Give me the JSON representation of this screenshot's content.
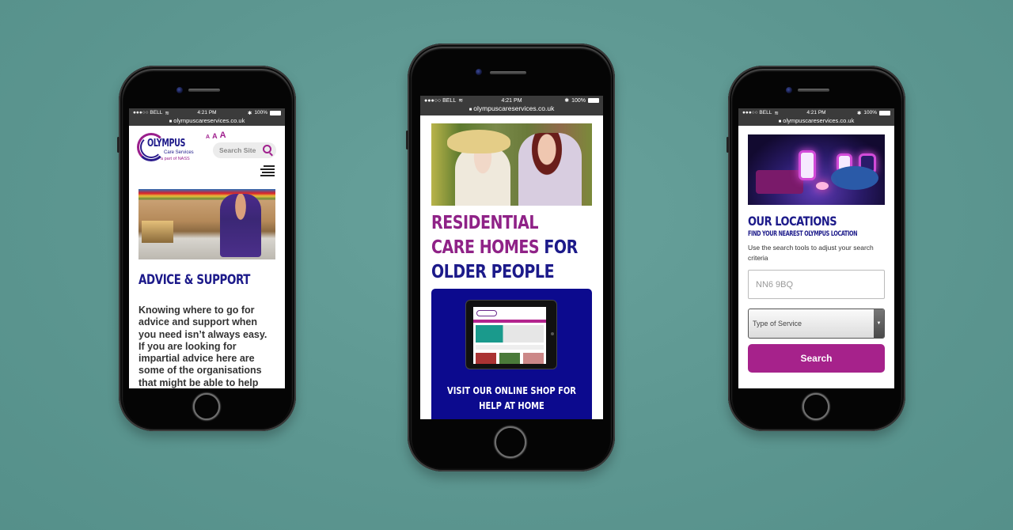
{
  "status_bar": {
    "carrier": "●●●○○ BELL",
    "wifi_icon": "wifi-icon",
    "time": "4:21 PM",
    "bluetooth_icon": "✱",
    "battery": "100%",
    "url_lock_icon": "🔒",
    "url": "olympuscareservices.co.uk"
  },
  "phone1": {
    "logo": {
      "name": "OLYMPUS",
      "subtitle": "Care Services",
      "tagline": "a part of NASS"
    },
    "text_size_controls": [
      "A",
      "A",
      "A"
    ],
    "search_placeholder": "Search Site",
    "heading": "ADVICE & SUPPORT",
    "body": "Knowing where to go for advice and support when you need isn’t always easy. If you are looking for impartial advice here are some of the organisations that might be able to help you"
  },
  "phone2": {
    "heading_purple_1": "RESIDENTIAL",
    "heading_purple_2": "CARE HOMES",
    "heading_blue_1": "FOR",
    "heading_blue_2": "OLDER PEOPLE",
    "shop_caption": "VISIT OUR ONLINE SHOP FOR HELP AT HOME"
  },
  "phone3": {
    "heading": "OUR LOCATIONS",
    "subheading": "FIND YOUR NEAREST OLYMPUS LOCATION",
    "description": "Use the search tools to adjust your search criteria",
    "postcode_value": "NN6 9BQ",
    "service_select": "Type of Service",
    "search_button": "Search"
  },
  "colors": {
    "background": "#5f9994",
    "brand_purple": "#a6228b",
    "brand_blue": "#1c1a8a",
    "shop_box": "#0c0a8e"
  }
}
